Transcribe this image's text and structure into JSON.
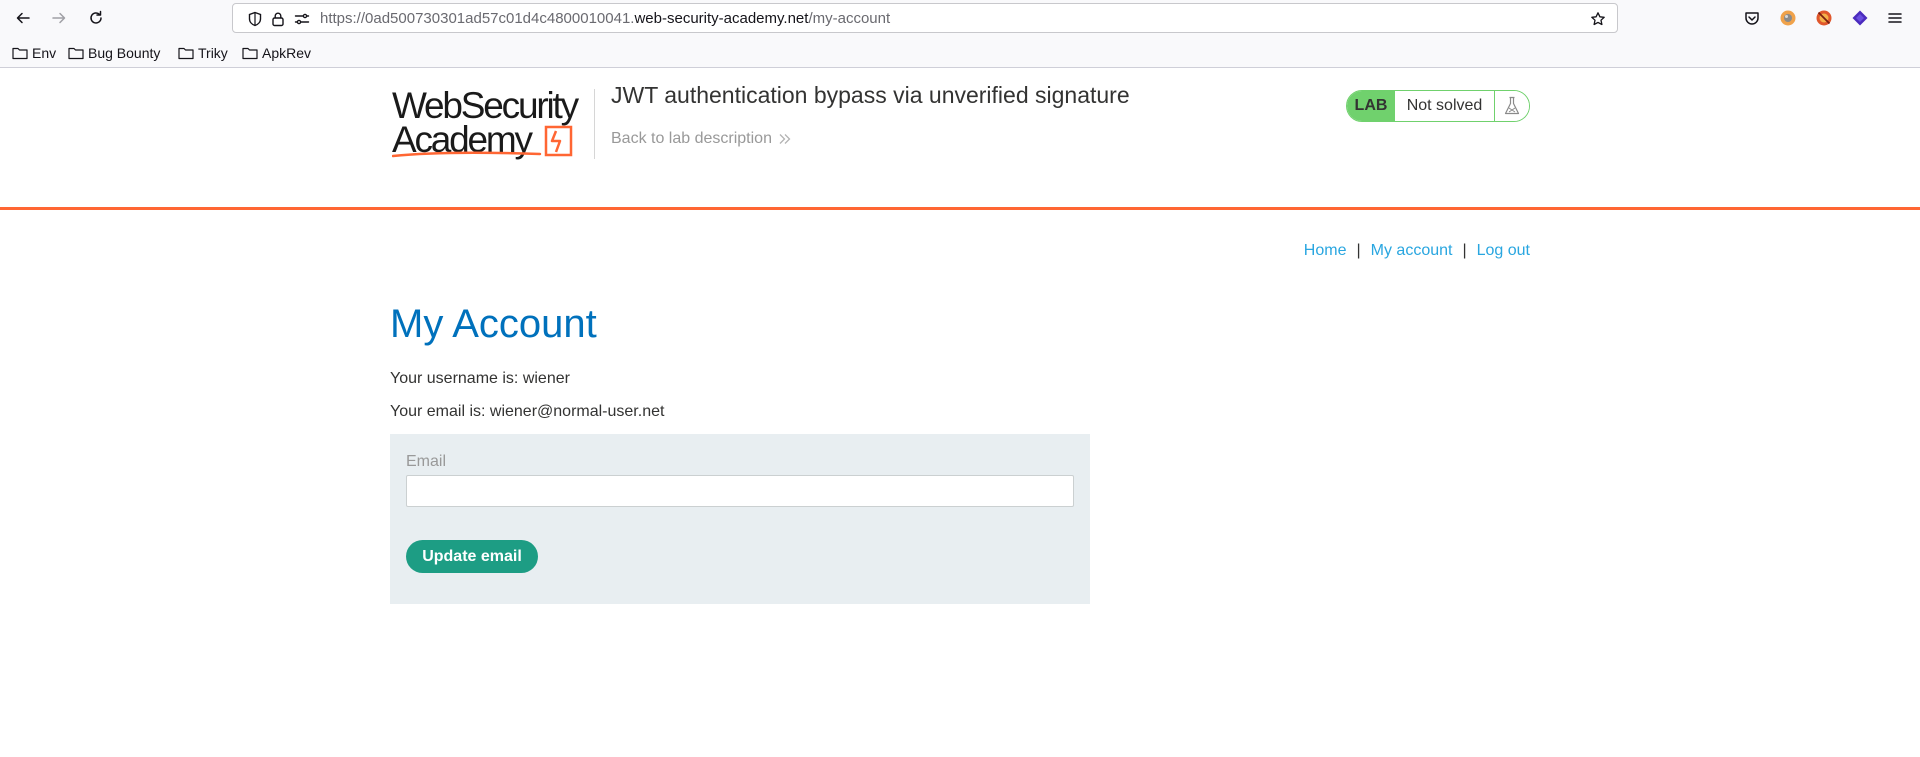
{
  "browser": {
    "url": {
      "prefix": "https://0ad500730301ad57c01d4c4800010041.",
      "host": "web-security-academy.net",
      "path": "/my-account"
    },
    "bookmarks": [
      {
        "label": "Env"
      },
      {
        "label": "Bug Bounty"
      },
      {
        "label": "Triky"
      },
      {
        "label": "ApkRev"
      }
    ]
  },
  "lab": {
    "logo": {
      "line1": "WebSecurity",
      "line2": "Academy"
    },
    "title": "JWT authentication bypass via unverified signature",
    "back_link": "Back to lab description",
    "status": {
      "badge": "LAB",
      "state": "Not solved"
    }
  },
  "nav": {
    "links": [
      {
        "label": "Home"
      },
      {
        "label": "My account"
      },
      {
        "label": "Log out"
      }
    ],
    "separator": "|"
  },
  "account": {
    "heading": "My Account",
    "username_line": "Your username is: wiener",
    "email_line": "Your email is: wiener@normal-user.net",
    "form": {
      "email_label": "Email",
      "email_value": "",
      "submit_label": "Update email"
    }
  },
  "colors": {
    "accent_orange": "#ff6633",
    "lab_green": "#70d16d",
    "title_blue": "#0071bc",
    "link_blue": "#29a6e0",
    "button_teal": "#1d9d84",
    "form_bg": "#e8eef1"
  },
  "icons": {
    "back": "arrow-left-icon",
    "forward": "arrow-right-icon",
    "reload": "reload-icon",
    "shield": "shield-icon",
    "lock": "lock-icon",
    "permissions": "permissions-icon",
    "bookmark_star": "star-icon",
    "pocket": "pocket-icon",
    "menu": "hamburger-menu-icon",
    "folder": "folder-icon",
    "flask": "flask-icon",
    "chevrons": "double-chevron-right-icon"
  }
}
